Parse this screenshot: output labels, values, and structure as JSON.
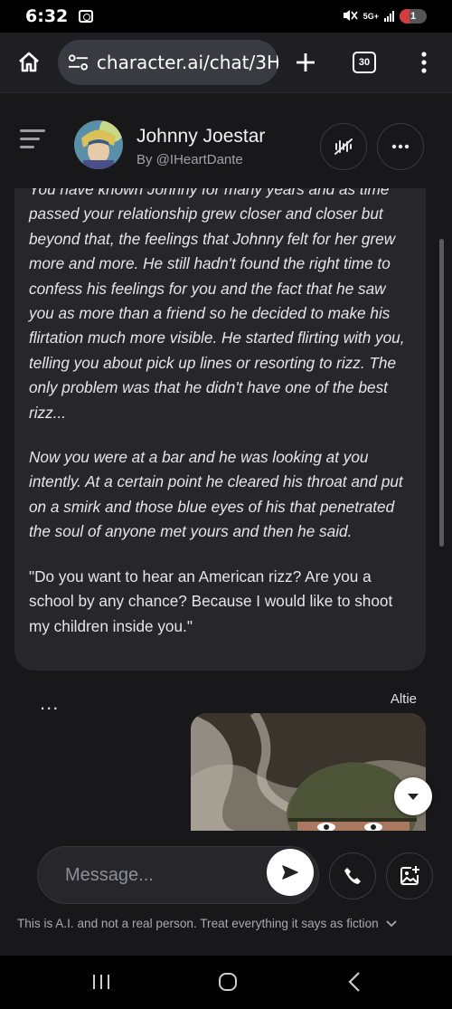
{
  "status_bar": {
    "time": "6:32",
    "network": "5G+",
    "battery_level": "1"
  },
  "browser": {
    "url": "character.ai/chat/3H:",
    "tab_count": "30"
  },
  "header": {
    "character_name": "Johnny Joestar",
    "author": "By @IHeartDante"
  },
  "message": {
    "cut_line": "You have known Johnny for many years and as time",
    "paragraphs": [
      {
        "text": "passed your relationship grew closer and closer but beyond that, the feelings that Johnny felt for her grew more and more. He still hadn't found the right time to confess his feelings for you and the fact that he saw you as more than a friend so he decided to make his flirtation much more visible. He started flirting with you, telling you about pick up lines or resorting to rizz. The only problem was that he didn't have one of the best rizz...",
        "italic": true
      },
      {
        "text": "Now you were at a bar and he was looking at you intently. At a certain point he cleared his throat and put on a smirk and those blue eyes of his that penetrated the soul of anyone met yours and then he said.",
        "italic": true
      },
      {
        "text": "\"Do you want to hear an American rizz? Are you a school by any chance? Because I would like to shoot my children inside you.\"",
        "italic": false
      }
    ]
  },
  "typing_indicator": "...",
  "user_message": {
    "user_name": "Altie"
  },
  "composer": {
    "placeholder": "Message...",
    "disclaimer": "This is A.I. and not a real person. Treat everything it says as fiction"
  },
  "colors": {
    "background": "#18181b",
    "bubble": "#26262b",
    "bar": "#1f1f23"
  }
}
